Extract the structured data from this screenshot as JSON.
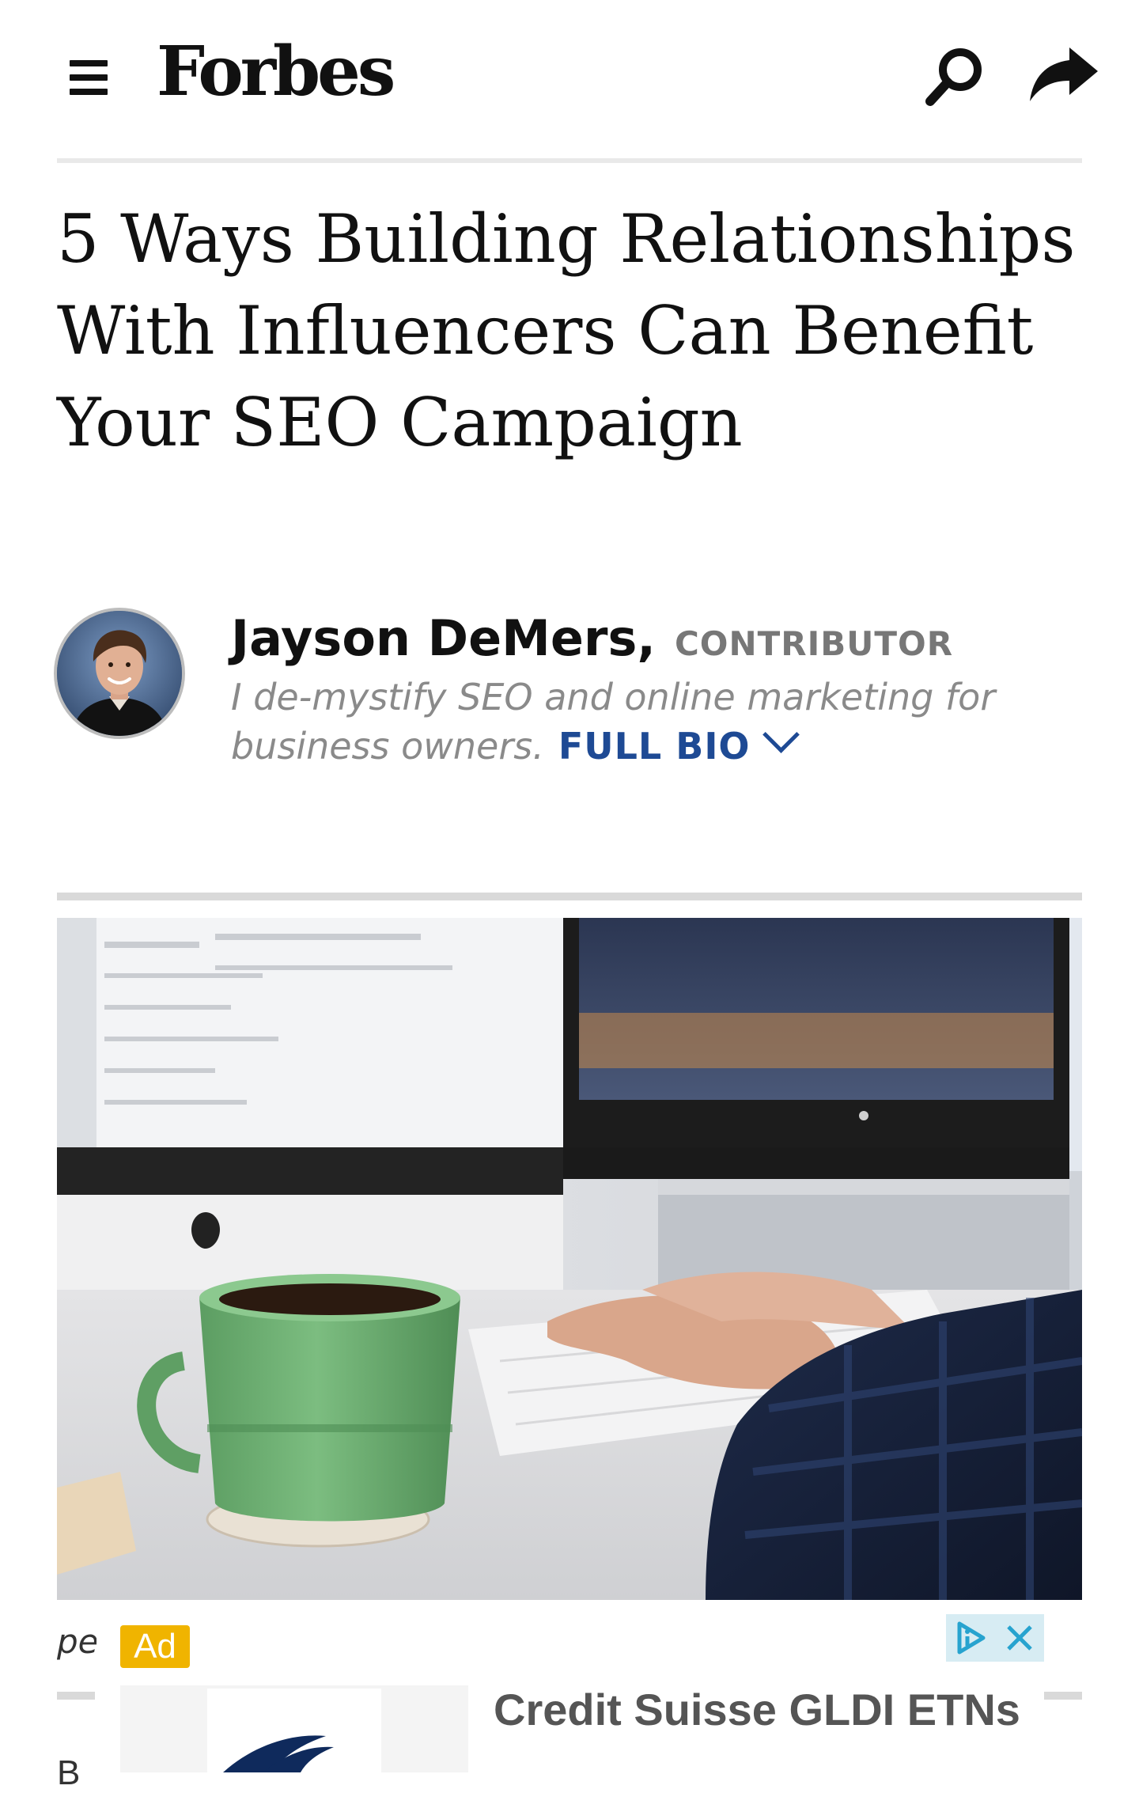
{
  "header": {
    "logo": "Forbes",
    "menu_icon": "hamburger-menu-icon",
    "search_icon": "search-icon",
    "share_icon": "share-arrow-icon"
  },
  "article": {
    "title": "5 Ways Building Relationships With Influencers Can Benefit Your SEO Campaign",
    "author": {
      "name": "Jayson DeMers,",
      "role": "CONTRIBUTOR",
      "bio": "I de-mystify SEO and online marketing for business owners.",
      "full_bio_label": "FULL BIO"
    }
  },
  "ad": {
    "caption_fragment": "pe",
    "badge": "Ad",
    "headline": "Credit Suisse GLDI ETNs",
    "clipped_fragment": "B"
  },
  "colors": {
    "link_blue": "#1e4a94",
    "ad_badge": "#f0b400",
    "adchoices_bg": "#d7ecf3",
    "mug_green": "#6fae73"
  }
}
